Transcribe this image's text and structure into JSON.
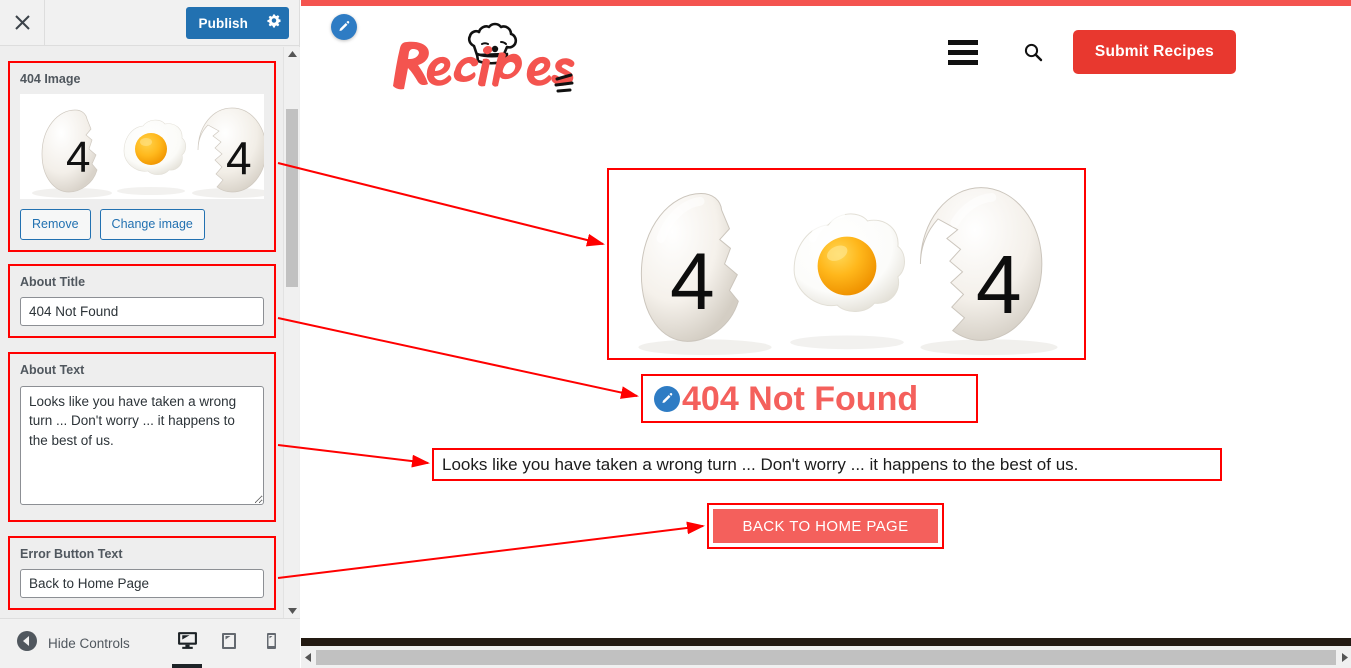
{
  "customizer": {
    "close_icon": "close-icon",
    "publish_label": "Publish",
    "gear_icon": "gear-icon",
    "hide_controls_label": "Hide Controls",
    "back_arrow_icon": "collapse-arrow-icon",
    "devices": [
      {
        "name": "desktop",
        "icon": "desktop-icon",
        "active": true
      },
      {
        "name": "tablet",
        "icon": "tablet-icon",
        "active": false
      },
      {
        "name": "mobile",
        "icon": "mobile-icon",
        "active": false
      }
    ],
    "controls": [
      {
        "id": "404-image",
        "label": "404 Image",
        "type": "image",
        "remove_label": "Remove",
        "change_label": "Change image"
      },
      {
        "id": "about-title",
        "label": "About Title",
        "type": "text",
        "value": "404 Not Found"
      },
      {
        "id": "about-text",
        "label": "About Text",
        "type": "textarea",
        "value": "Looks like you have taken a wrong turn ... Don't worry ... it happens to the best of us."
      },
      {
        "id": "error-button-text",
        "label": "Error Button Text",
        "type": "text",
        "value": "Back to Home Page"
      }
    ]
  },
  "preview": {
    "top_bar_color": "#f4544f",
    "site": {
      "logo_text": "Recipes",
      "logo_color": "#f4544f",
      "menu_icon": "hamburger-menu-icon",
      "search_icon": "search-icon",
      "submit_button_label": "Submit Recipes",
      "submit_button_color": "#e8382f",
      "edit_pencil_icon": "edit-pencil-icon"
    },
    "error_page": {
      "image_alt": "404 cracked eggs image",
      "title": "404 Not Found",
      "title_color": "#f4605c",
      "title_edit_icon": "edit-pencil-icon",
      "text": "Looks like you have taken a wrong turn ... Don't worry ... it happens to the best of us.",
      "button_label": "BACK TO HOME PAGE",
      "button_color": "#f4605c"
    }
  },
  "annotations": {
    "highlight_color": "#ff0000"
  }
}
